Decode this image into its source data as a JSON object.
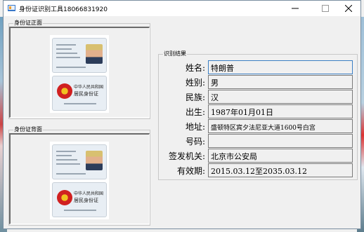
{
  "window": {
    "title": "身份证识别工具18066831920",
    "controls": {
      "minimize": "—",
      "maximize": "☐",
      "close": "✕"
    }
  },
  "front": {
    "group_label": "身份证正面",
    "card": {
      "title_cn_line1": "中华人民共和国",
      "title_cn_line2": "居民身份证"
    }
  },
  "back": {
    "group_label": "身份证背面",
    "card": {
      "title_cn_line1": "中华人民共和国",
      "title_cn_line2": "居民身份证"
    }
  },
  "result": {
    "group_label": "识别结果",
    "fields": [
      {
        "label": "姓名:",
        "value": "特朗普"
      },
      {
        "label": "姓别:",
        "value": "男"
      },
      {
        "label": "民族:",
        "value": "汉"
      },
      {
        "label": "出生:",
        "value": "1987年01月01日"
      },
      {
        "label": "地址:",
        "value": "盛顿特区宾夕法尼亚大道1600号白宫"
      },
      {
        "label": "号码:",
        "value": ""
      },
      {
        "label": "签发机关:",
        "value": "北京市公安局"
      },
      {
        "label": "有效期:",
        "value": "2015.03.12至2035.03.12"
      }
    ]
  },
  "colors": {
    "window_bg": "#f0f0f0",
    "focus_border": "#3b7fc4",
    "emblem_red": "#d02020"
  }
}
